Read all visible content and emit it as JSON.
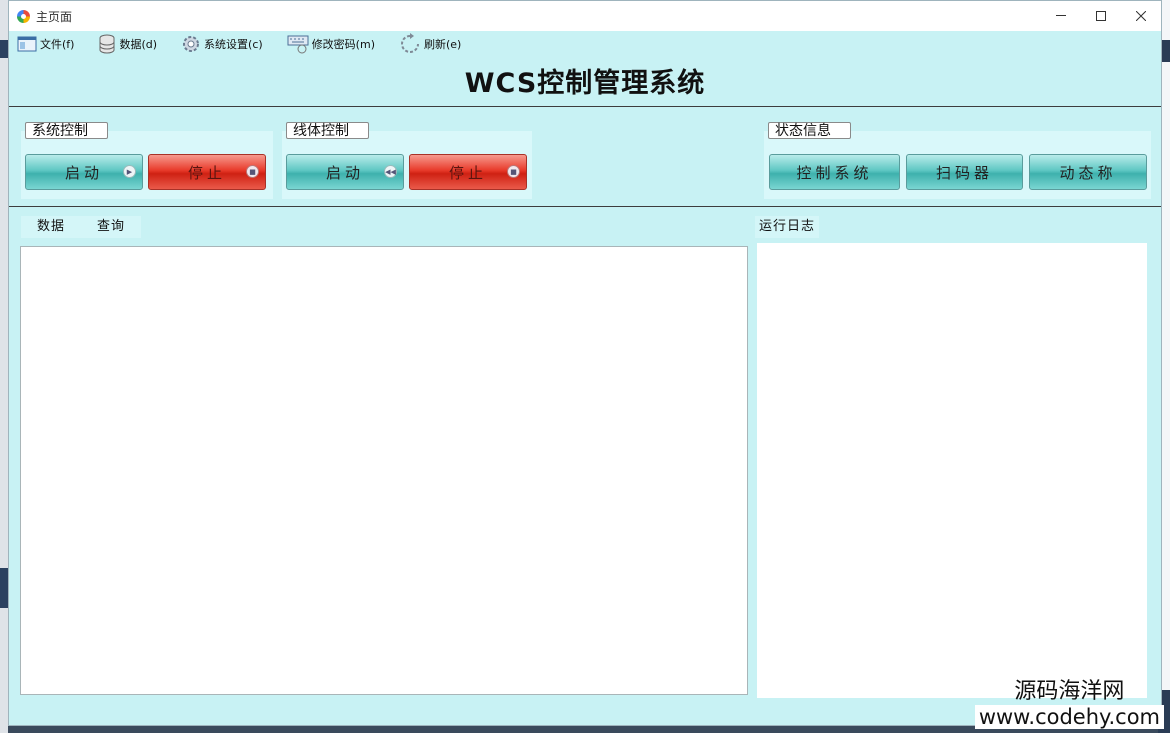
{
  "window": {
    "title": "主页面",
    "minimize_icon": "minimize-icon",
    "maximize_icon": "maximize-icon",
    "close_icon": "close-icon"
  },
  "menu": [
    {
      "label": "文件(f)",
      "icon": "folder-window-icon"
    },
    {
      "label": "数据(d)",
      "icon": "database-icon"
    },
    {
      "label": "系统设置(c)",
      "icon": "gear-icon"
    },
    {
      "label": "修改密码(m)",
      "icon": "keyboard-icon"
    },
    {
      "label": "刷新(e)",
      "icon": "refresh-icon"
    }
  ],
  "header": {
    "title": "WCS控制管理系统"
  },
  "system_control": {
    "label": "系统控制",
    "start": "启动",
    "stop": "停止"
  },
  "line_control": {
    "label": "线体控制",
    "start": "启动",
    "stop": "停止"
  },
  "status_info": {
    "label": "状态信息",
    "buttons": [
      "控制系统",
      "扫码器",
      "动态称"
    ]
  },
  "data_panel": {
    "tabs": [
      "数据",
      "查询"
    ]
  },
  "log_panel": {
    "label": "运行日志"
  },
  "watermark": {
    "line1": "源码海洋网",
    "line2": "www.codehy.com"
  },
  "colors": {
    "window_bg": "#c8f2f4",
    "teal_button": "#3eb1ad",
    "red_button": "#cf2113"
  }
}
